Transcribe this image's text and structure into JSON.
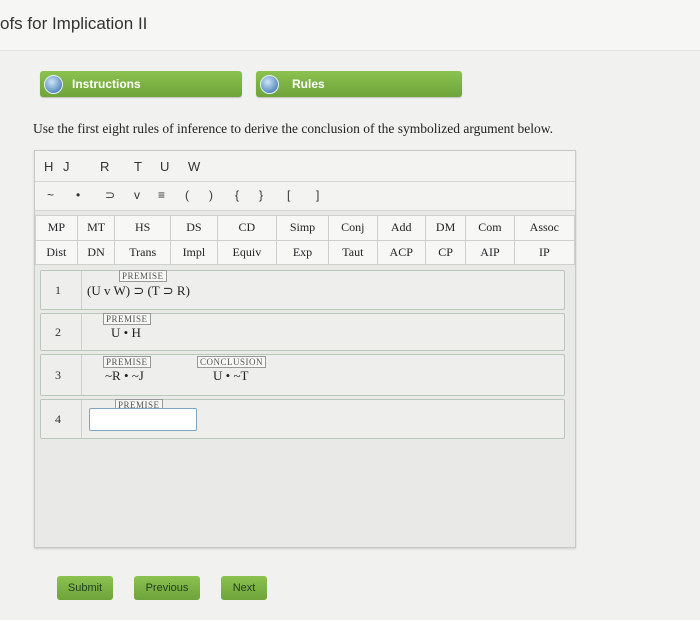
{
  "header": {
    "title": "ofs for Implication II"
  },
  "tabs": {
    "instructions": "Instructions",
    "rules": "Rules"
  },
  "directions": "Use the first eight rules of inference to derive the conclusion of the symbolized argument below.",
  "variables": [
    "H",
    "J",
    "R",
    "T",
    "U",
    "W"
  ],
  "symbols": [
    "~",
    "•",
    "⊃",
    "v",
    "≡",
    "(",
    ")",
    "{",
    "}",
    "[",
    "]"
  ],
  "rules": {
    "row1": [
      "MP",
      "MT",
      "HS",
      "DS",
      "CD",
      "Simp",
      "Conj",
      "Add",
      "DM",
      "Com",
      "Assoc"
    ],
    "row2": [
      "Dist",
      "DN",
      "Trans",
      "Impl",
      "Equiv",
      "Exp",
      "Taut",
      "ACP",
      "CP",
      "AIP",
      "IP"
    ]
  },
  "lines": [
    {
      "num": "1",
      "tag": "PREMISE",
      "formula": "(U v W) ⊃ (T ⊃ R)"
    },
    {
      "num": "2",
      "tag": "PREMISE",
      "formula": "U • H"
    },
    {
      "num": "3",
      "tag": "PREMISE",
      "formula": "~R • ~J",
      "conclusion_tag": "CONCLUSION",
      "conclusion": "U • ~T"
    },
    {
      "num": "4",
      "tag": "PREMISE",
      "input_value": ""
    }
  ],
  "buttons": {
    "submit": "Submit",
    "previous": "Previous",
    "next": "Next"
  },
  "colors": {
    "accent_green": "#7ab445",
    "panel_bg": "#e9e9e8"
  }
}
